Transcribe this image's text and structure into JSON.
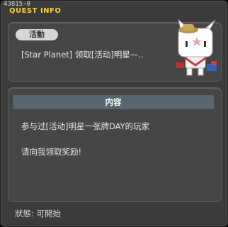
{
  "window": {
    "quest_id": "43815-0",
    "title": "QUEST INFO"
  },
  "quest": {
    "category": "活動",
    "name": "[Star Planet] 领取[活动]明星—..",
    "npc_icon": "white-cat-npc-with-star-hat"
  },
  "details": {
    "header": "内容",
    "line1": "参与过[活动]明星一张牌DAY的玩家",
    "line2": "请向我领取奖励!"
  },
  "footer": {
    "status": "狀態: 可開始"
  },
  "colors": {
    "title": "#ffd21f",
    "panel": "#464646",
    "header_bar": "#586670"
  }
}
